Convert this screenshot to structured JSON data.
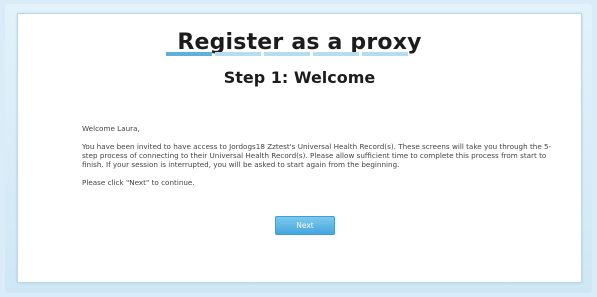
{
  "title": "Register as a proxy",
  "progress": {
    "total_steps": 5,
    "current_step": 1
  },
  "step_title": "Step 1: Welcome",
  "greeting": "Welcome Laura,",
  "body_text": "You have been invited to have access to Jordogs18 Zztest's Universal Health Record(s). These screens will take you through the 5-step process of connecting to their Universal Health Record(s). Please allow sufficient time to complete this process from start to finish. If your session is interrupted, you will be asked to start again from the beginning.",
  "instruction": "Please click \"Next\" to continue.",
  "buttons": {
    "next_label": "Next"
  },
  "colors": {
    "accent": "#5cb0da",
    "progress_inactive": "#b6dcef",
    "button": "#45a6dd"
  }
}
